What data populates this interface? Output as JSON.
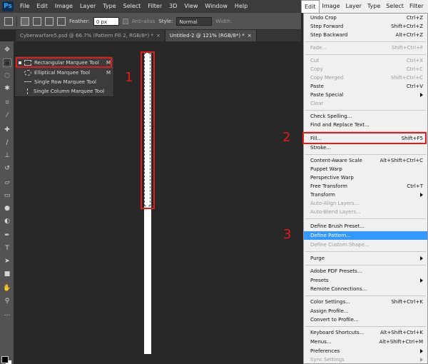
{
  "menubar": {
    "logo": "Ps",
    "items": [
      "File",
      "Edit",
      "Image",
      "Layer",
      "Type",
      "Select",
      "Filter",
      "3D",
      "View",
      "Window",
      "Help"
    ],
    "right_items": [
      "Edit",
      "Image",
      "Layer",
      "Type",
      "Select",
      "Filter"
    ]
  },
  "options": {
    "feather_label": "Feather:",
    "feather_value": "0 px",
    "antialias_label": "Anti-alias",
    "style_label": "Style:",
    "style_value": "Normal",
    "width_label": "Width:"
  },
  "tabs": [
    {
      "label": "Cyberwarfare5.psd @ 66.7% (Pattern Fill 2, RGB/8*) *",
      "close": "×"
    },
    {
      "label": "Untitled-2 @ 121% (RGB/8*) *",
      "close": "×"
    }
  ],
  "toolbox": {
    "tools": [
      "move-tool",
      "marquee-tool",
      "lasso-tool",
      "quick-select-tool",
      "crop-tool",
      "eyedropper-tool",
      "healing-tool",
      "brush-tool",
      "clone-stamp-tool",
      "history-brush-tool",
      "eraser-tool",
      "gradient-tool",
      "blur-tool",
      "dodge-tool",
      "pen-tool",
      "type-tool",
      "path-select-tool",
      "shape-tool",
      "hand-tool",
      "zoom-tool"
    ],
    "foreground_color": "#000000",
    "background_color": "#ffffff"
  },
  "flyout": {
    "items": [
      {
        "label": "Rectangular Marquee Tool",
        "key": "M"
      },
      {
        "label": "Elliptical Marquee Tool",
        "key": "M"
      },
      {
        "label": "Single Row Marquee Tool",
        "key": ""
      },
      {
        "label": "Single Column Marquee Tool",
        "key": ""
      }
    ]
  },
  "steps": {
    "one": "1",
    "two": "2",
    "three": "3"
  },
  "edit_menu": {
    "items": [
      {
        "label": "Undo Crop",
        "shortcut": "Ctrl+Z"
      },
      {
        "label": "Step Forward",
        "shortcut": "Shift+Ctrl+Z"
      },
      {
        "label": "Step Backward",
        "shortcut": "Alt+Ctrl+Z"
      },
      {
        "label": "Fade...",
        "shortcut": "Shift+Ctrl+F"
      },
      {
        "label": "Cut",
        "shortcut": "Ctrl+X"
      },
      {
        "label": "Copy",
        "shortcut": "Ctrl+C"
      },
      {
        "label": "Copy Merged",
        "shortcut": "Shift+Ctrl+C"
      },
      {
        "label": "Paste",
        "shortcut": "Ctrl+V"
      },
      {
        "label": "Paste Special",
        "shortcut": ""
      },
      {
        "label": "Clear",
        "shortcut": ""
      },
      {
        "label": "Check Spelling...",
        "shortcut": ""
      },
      {
        "label": "Find and Replace Text...",
        "shortcut": ""
      },
      {
        "label": "Fill...",
        "shortcut": "Shift+F5"
      },
      {
        "label": "Stroke...",
        "shortcut": ""
      },
      {
        "label": "Content-Aware Scale",
        "shortcut": "Alt+Shift+Ctrl+C"
      },
      {
        "label": "Puppet Warp",
        "shortcut": ""
      },
      {
        "label": "Perspective Warp",
        "shortcut": ""
      },
      {
        "label": "Free Transform",
        "shortcut": "Ctrl+T"
      },
      {
        "label": "Transform",
        "shortcut": ""
      },
      {
        "label": "Auto-Align Layers...",
        "shortcut": ""
      },
      {
        "label": "Auto-Blend Layers...",
        "shortcut": ""
      },
      {
        "label": "Define Brush Preset...",
        "shortcut": ""
      },
      {
        "label": "Define Pattern...",
        "shortcut": ""
      },
      {
        "label": "Define Custom Shape...",
        "shortcut": ""
      },
      {
        "label": "Purge",
        "shortcut": ""
      },
      {
        "label": "Adobe PDF Presets...",
        "shortcut": ""
      },
      {
        "label": "Presets",
        "shortcut": ""
      },
      {
        "label": "Remote Connections...",
        "shortcut": ""
      },
      {
        "label": "Color Settings...",
        "shortcut": "Shift+Ctrl+K"
      },
      {
        "label": "Assign Profile...",
        "shortcut": ""
      },
      {
        "label": "Convert to Profile...",
        "shortcut": ""
      },
      {
        "label": "Keyboard Shortcuts...",
        "shortcut": "Alt+Shift+Ctrl+K"
      },
      {
        "label": "Menus...",
        "shortcut": "Alt+Shift+Ctrl+M"
      },
      {
        "label": "Preferences",
        "shortcut": ""
      },
      {
        "label": "Sync Settings",
        "shortcut": ""
      }
    ]
  },
  "colors": {
    "highlight": "#3399ff",
    "annotation": "#e31b1b"
  }
}
